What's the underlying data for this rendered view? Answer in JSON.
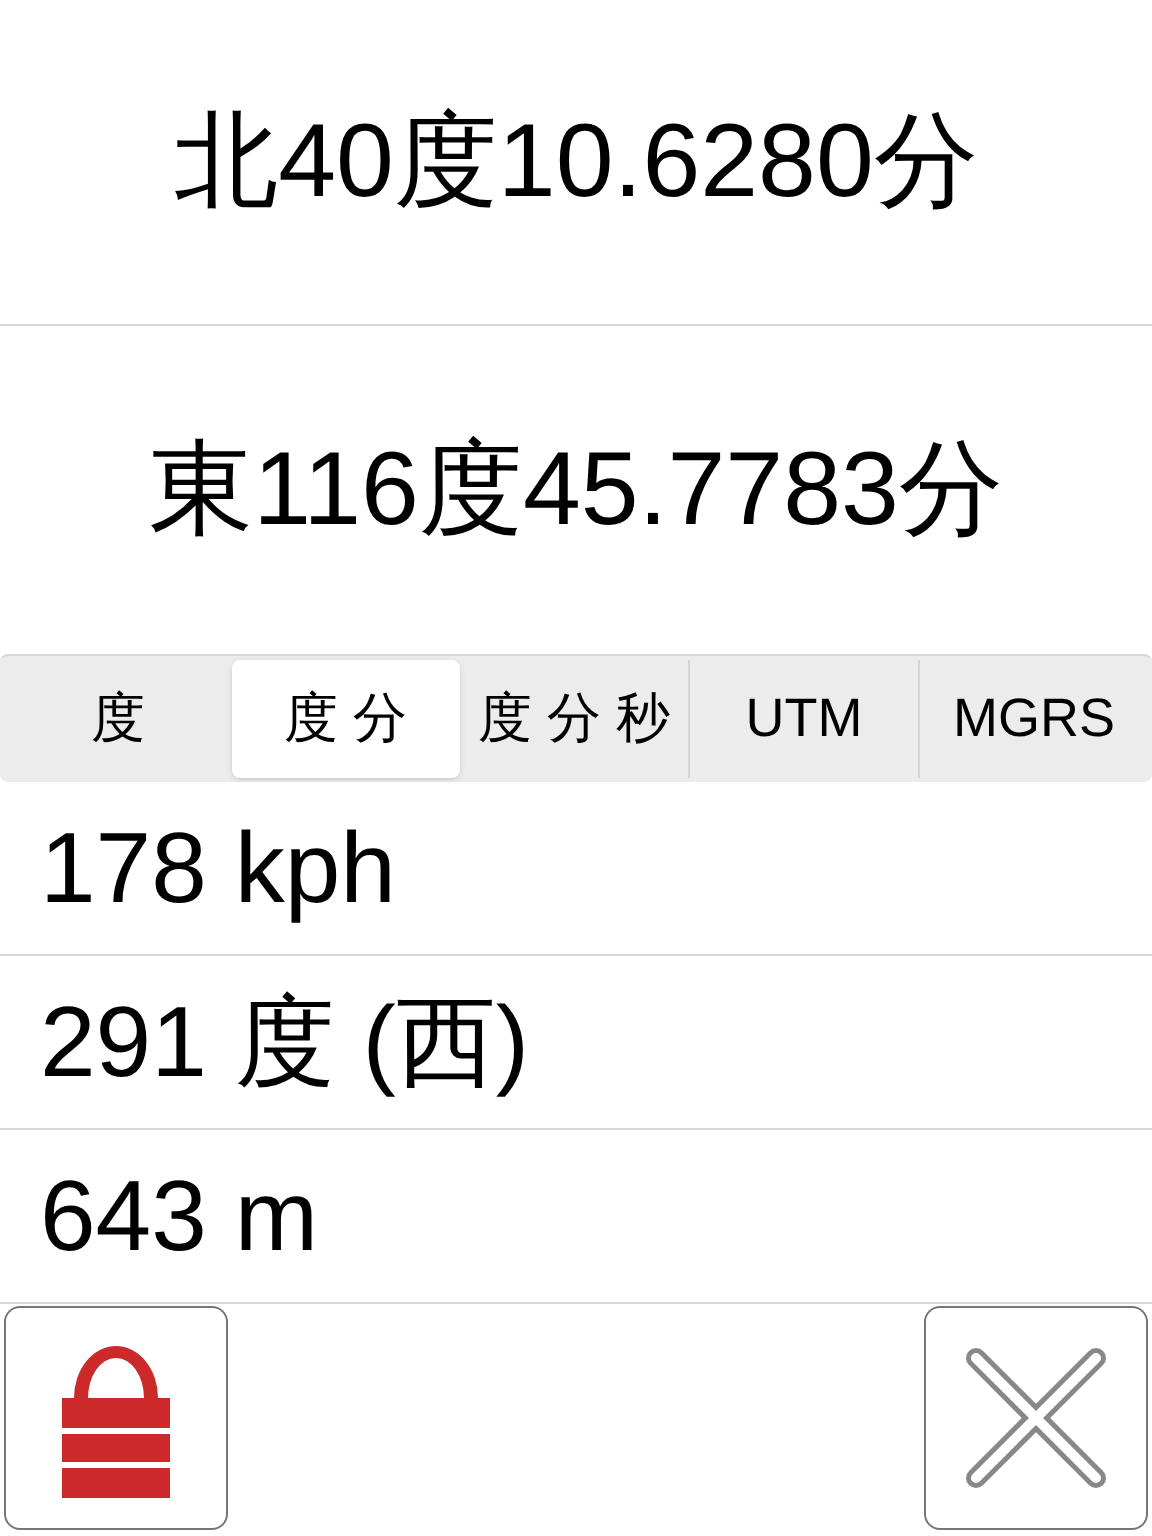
{
  "latitude": "北40度10.6280分",
  "longitude": "東116度45.7783分",
  "format_tabs": [
    {
      "label": "度",
      "selected": false
    },
    {
      "label": "度 分",
      "selected": true
    },
    {
      "label": "度 分 秒",
      "selected": false
    },
    {
      "label": "UTM",
      "selected": false
    },
    {
      "label": "MGRS",
      "selected": false
    }
  ],
  "readings": [
    "178 kph",
    "291 度 (西)",
    "643 m"
  ],
  "lock": {
    "locked": true
  }
}
